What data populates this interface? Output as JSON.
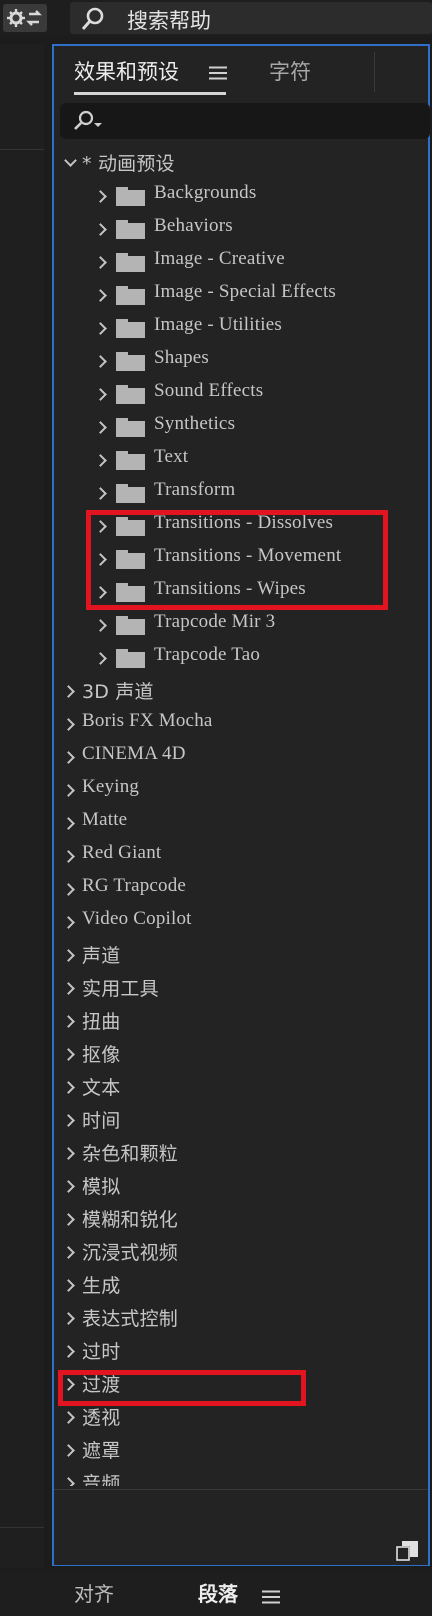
{
  "top_bar": {
    "help_text": "搜索帮助"
  },
  "tabs": {
    "effects": "效果和预设",
    "character": "字符"
  },
  "tree": {
    "root": "* 动画预设",
    "presets": [
      "Backgrounds",
      "Behaviors",
      "Image - Creative",
      "Image - Special Effects",
      "Image - Utilities",
      "Shapes",
      "Sound Effects",
      "Synthetics",
      "Text",
      "Transform",
      "Transitions - Dissolves",
      "Transitions - Movement",
      "Transitions - Wipes",
      "Trapcode Mir 3",
      "Trapcode Tao"
    ],
    "categories": [
      "3D 声道",
      "Boris FX Mocha",
      "CINEMA 4D",
      "Keying",
      "Matte",
      "Red Giant",
      "RG Trapcode",
      "Video Copilot",
      "声道",
      "实用工具",
      "扭曲",
      "抠像",
      "文本",
      "时间",
      "杂色和颗粒",
      "模拟",
      "模糊和锐化",
      "沉浸式视频",
      "生成",
      "表达式控制",
      "过时",
      "过渡",
      "透视",
      "遮罩",
      "音频"
    ]
  },
  "bottom_tabs": {
    "align": "对齐",
    "paragraph": "段落"
  },
  "colors": {
    "highlight": "#e1141f",
    "panel_border": "#2e6fc7"
  }
}
